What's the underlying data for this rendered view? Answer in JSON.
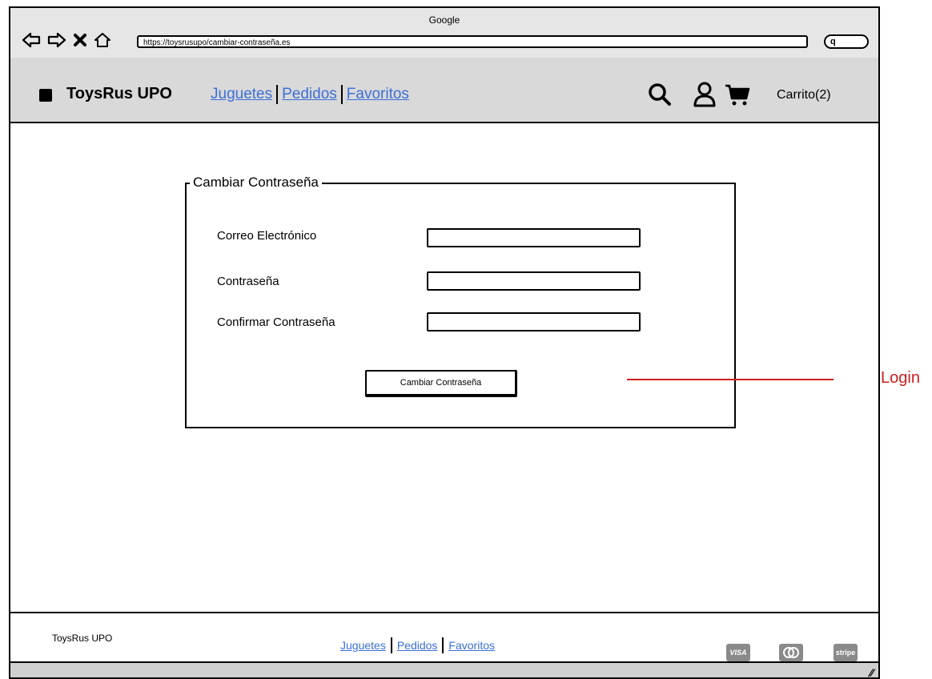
{
  "browser": {
    "window_title": "Google",
    "url": "https://toysrusupo/cambiar-contraseña.es",
    "search_glyph": "q"
  },
  "header": {
    "brand": "ToysRus UPO",
    "nav": [
      "Juguetes",
      "Pedidos",
      "Favoritos"
    ],
    "cart_label": "Carrito(2)"
  },
  "form": {
    "legend": "Cambiar Contraseña",
    "fields": [
      {
        "label": "Correo Electrónico",
        "value": ""
      },
      {
        "label": "Contraseña",
        "value": ""
      },
      {
        "label": "Confirmar Contraseña",
        "value": ""
      }
    ],
    "submit_label": "Cambiar Contraseña"
  },
  "footer": {
    "brand": "ToysRus UPO",
    "nav": [
      "Juguetes",
      "Pedidos",
      "Favoritos"
    ],
    "payments": [
      "VISA",
      "",
      "stripe"
    ]
  },
  "annotation": {
    "text": "Login",
    "color": "#cc1e1e"
  },
  "colors": {
    "link": "#3b6fd8",
    "header_bg": "#d9d9d9",
    "titlebar_bg": "#e6e6e6"
  },
  "icons": [
    "back-icon",
    "forward-icon",
    "close-icon",
    "home-icon",
    "search-icon",
    "user-icon",
    "cart-icon",
    "logo-icon",
    "visa-icon",
    "mastercard-icon",
    "stripe-icon",
    "resize-grip-icon"
  ]
}
